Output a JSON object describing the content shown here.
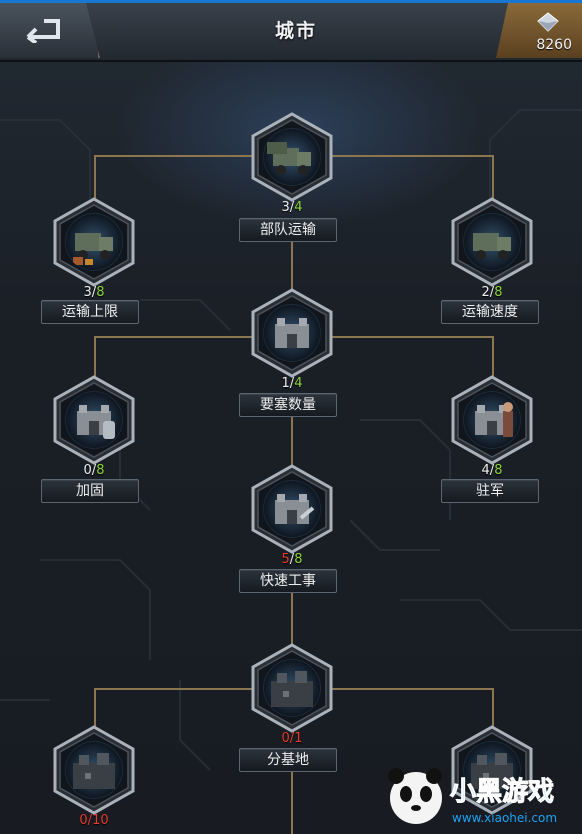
{
  "header": {
    "title": "城市",
    "currency_amount": "8260"
  },
  "nodes": [
    {
      "id": "troop-transport",
      "label": "部队运输",
      "current": "3",
      "max": "4",
      "icon": "trucks-icon"
    },
    {
      "id": "transport-cap",
      "label": "运输上限",
      "current": "3",
      "max": "8",
      "icon": "truck-cargo-icon"
    },
    {
      "id": "transport-speed",
      "label": "运输速度",
      "current": "2",
      "max": "8",
      "icon": "truck-icon"
    },
    {
      "id": "fortress-count",
      "label": "要塞数量",
      "current": "1",
      "max": "4",
      "icon": "fortress-icon"
    },
    {
      "id": "reinforce",
      "label": "加固",
      "current": "0",
      "max": "8",
      "icon": "fortress-armor-icon"
    },
    {
      "id": "garrison",
      "label": "驻军",
      "current": "4",
      "max": "8",
      "icon": "fortress-soldier-icon"
    },
    {
      "id": "quick-fortify",
      "label": "快速工事",
      "current": "5",
      "max": "8",
      "icon": "fortress-build-icon"
    },
    {
      "id": "sub-base",
      "label": "分基地",
      "current": "0",
      "max": "1",
      "icon": "base-icon"
    },
    {
      "id": "base-left",
      "label": "",
      "current": "0",
      "max": "10",
      "icon": "base-armor-icon"
    },
    {
      "id": "base-right",
      "label": "",
      "current": "",
      "max": "",
      "icon": "base-icon"
    }
  ],
  "colors": {
    "maxed_green": "#8dd43a",
    "locked_red": "#e53b2c",
    "connector": "#8b7650"
  },
  "watermark": {
    "brand": "小黑游戏",
    "url": "www.xiaohei.com"
  }
}
